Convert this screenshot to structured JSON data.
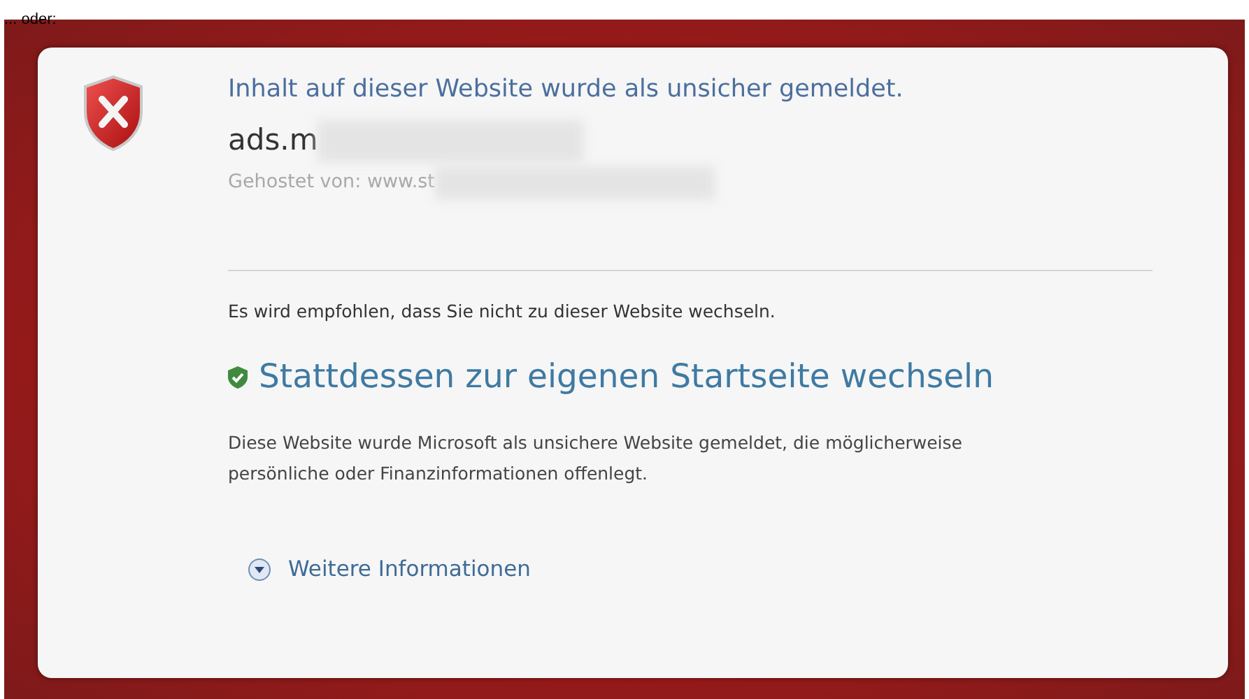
{
  "caption": "... oder:",
  "dialog": {
    "title": "Inhalt auf dieser Website wurde als unsicher gemeldet.",
    "site": "ads.m",
    "hosted_by": "Gehostet von:  www.st",
    "recommendation": "Es wird empfohlen, dass Sie nicht zu dieser Website wechseln.",
    "safe_link": "Stattdessen zur eigenen Startseite wechseln",
    "explanation": "Diese Website wurde Microsoft als unsichere Website gemeldet, die möglicherweise persönliche oder Finanzinformationen offenlegt.",
    "more_info": {
      "label": "Weitere Informationen",
      "expanded": false
    }
  }
}
